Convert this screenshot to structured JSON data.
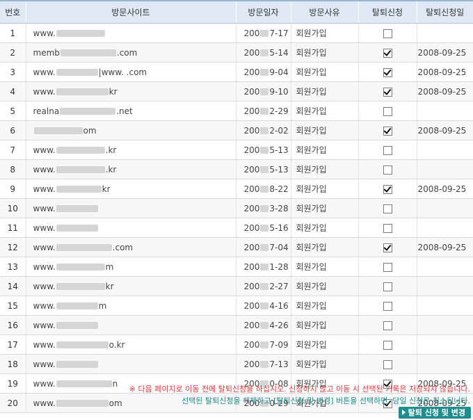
{
  "columns": {
    "no": "번호",
    "site": "방문사이트",
    "date": "방문일자",
    "reason": "방문사유",
    "request": "탈퇴신청",
    "withdraw_date": "탈퇴신청일"
  },
  "rows": [
    {
      "no": "1",
      "site_pre": "www.",
      "site_post": "",
      "date_pre": "200",
      "date_post": "7-17",
      "reason": "회원가입",
      "checked": false,
      "withdraw_date": ""
    },
    {
      "no": "2",
      "site_pre": "memb",
      "site_post": ".com",
      "date_pre": "200",
      "date_post": "5-14",
      "reason": "회원가입",
      "checked": true,
      "withdraw_date": "2008-09-25"
    },
    {
      "no": "3",
      "site_pre": "www.",
      "site_post": "|www.      .com",
      "date_pre": "200",
      "date_post": "9-04",
      "reason": "회원가입",
      "checked": true,
      "withdraw_date": "2008-09-25"
    },
    {
      "no": "4",
      "site_pre": "www.",
      "site_post": "kr",
      "date_pre": "200",
      "date_post": "9-10",
      "reason": "회원가입",
      "checked": true,
      "withdraw_date": "2008-09-25"
    },
    {
      "no": "5",
      "site_pre": "realna",
      "site_post": ".net",
      "date_pre": "200",
      "date_post": "2-29",
      "reason": "회원가입",
      "checked": false,
      "withdraw_date": ""
    },
    {
      "no": "6",
      "site_pre": "",
      "site_post": "om",
      "date_pre": "200",
      "date_post": "2-02",
      "reason": "회원가입",
      "checked": true,
      "withdraw_date": "2008-09-25"
    },
    {
      "no": "7",
      "site_pre": "www.",
      "site_post": ".kr",
      "date_pre": "200",
      "date_post": "5-13",
      "reason": "회원가입",
      "checked": false,
      "withdraw_date": ""
    },
    {
      "no": "8",
      "site_pre": "www.",
      "site_post": ".kr",
      "date_pre": "200",
      "date_post": "5-13",
      "reason": "회원가입",
      "checked": false,
      "withdraw_date": ""
    },
    {
      "no": "9",
      "site_pre": "www.",
      "site_post": "kr",
      "date_pre": "200",
      "date_post": "8-22",
      "reason": "회원가입",
      "checked": true,
      "withdraw_date": "2008-09-25"
    },
    {
      "no": "10",
      "site_pre": "www.",
      "site_post": "",
      "date_pre": "200",
      "date_post": "3-28",
      "reason": "회원가입",
      "checked": false,
      "withdraw_date": ""
    },
    {
      "no": "11",
      "site_pre": "www.",
      "site_post": "",
      "date_pre": "200",
      "date_post": "5-16",
      "reason": "회원가입",
      "checked": false,
      "withdraw_date": ""
    },
    {
      "no": "12",
      "site_pre": "www.",
      "site_post": ".com",
      "date_pre": "200",
      "date_post": "7-04",
      "reason": "회원가입",
      "checked": true,
      "withdraw_date": "2008-09-25"
    },
    {
      "no": "13",
      "site_pre": "www.",
      "site_post": "m",
      "date_pre": "200",
      "date_post": "1-28",
      "reason": "회원가입",
      "checked": false,
      "withdraw_date": ""
    },
    {
      "no": "14",
      "site_pre": "www.",
      "site_post": "kr",
      "date_pre": "200",
      "date_post": "2-27",
      "reason": "회원가입",
      "checked": false,
      "withdraw_date": ""
    },
    {
      "no": "15",
      "site_pre": "www.",
      "site_post": "m",
      "date_pre": "200",
      "date_post": "4-16",
      "reason": "회원가입",
      "checked": false,
      "withdraw_date": ""
    },
    {
      "no": "16",
      "site_pre": "www.",
      "site_post": "",
      "date_pre": "200",
      "date_post": "4-26",
      "reason": "회원가입",
      "checked": false,
      "withdraw_date": ""
    },
    {
      "no": "17",
      "site_pre": "www.",
      "site_post": "o.kr",
      "date_pre": "200",
      "date_post": "7-09",
      "reason": "회원가입",
      "checked": false,
      "withdraw_date": ""
    },
    {
      "no": "18",
      "site_pre": "www.",
      "site_post": "",
      "date_pre": "200",
      "date_post": "7-13",
      "reason": "회원가입",
      "checked": false,
      "withdraw_date": ""
    },
    {
      "no": "19",
      "site_pre": "www.",
      "site_post": "n",
      "date_pre": "200",
      "date_post": "0-08",
      "reason": "회원가입",
      "checked": true,
      "withdraw_date": "2008-09-25"
    },
    {
      "no": "20",
      "site_pre": "www.",
      "site_post": "om",
      "date_pre": "200",
      "date_post": "0-29",
      "reason": "회원가입",
      "checked": true,
      "withdraw_date": "2008-09-25"
    }
  ],
  "notice_line1": "※ 다음 페이지로 이동 전에 탈퇴신청을 하십시오. 신청하지 않고 이동 시 선택된 기록은 저장되지 않습니다.",
  "notice_line2": "선택된 탈퇴신청을 해제하고 [탈퇴신청 및 변경] 버튼을 선택하면, 당일 신청은 취소됩니다.",
  "submit_label": "탈퇴 신청 및 변경",
  "colors": {
    "header_bg": "#dfe8f5",
    "notice_red": "#d93a3a",
    "notice_teal": "#1b8b8b",
    "button_bg": "#1f8d8d"
  }
}
